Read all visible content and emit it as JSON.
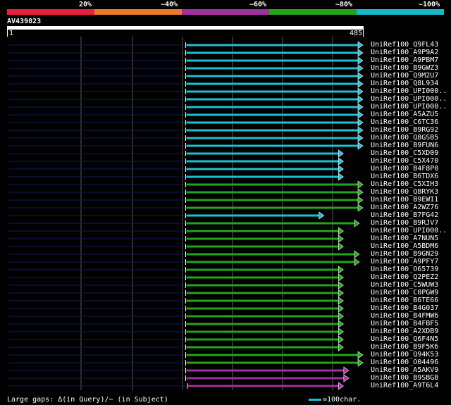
{
  "legend": {
    "labels": [
      "20%",
      "~40%",
      "~60%",
      "~80%",
      "~100%"
    ],
    "colors": [
      "#e8203c",
      "#e8782a",
      "#a0309c",
      "#28a01c",
      "#18b8c8"
    ]
  },
  "query": {
    "name": "AV439823",
    "start": "1",
    "end": "485"
  },
  "hits": [
    {
      "name": "UniRef100_Q9FL43",
      "start": 0.5,
      "end": 1.0,
      "color": "cyan"
    },
    {
      "name": "UniRef100_A9P9A2",
      "start": 0.5,
      "end": 1.0,
      "color": "cyan"
    },
    {
      "name": "UniRef100_A9PBM7",
      "start": 0.5,
      "end": 1.0,
      "color": "cyan"
    },
    {
      "name": "UniRef100_B9GWZ3",
      "start": 0.5,
      "end": 1.0,
      "color": "cyan"
    },
    {
      "name": "UniRef100_Q9M2U7",
      "start": 0.5,
      "end": 1.0,
      "color": "cyan"
    },
    {
      "name": "UniRef100_Q8L934",
      "start": 0.5,
      "end": 1.0,
      "color": "cyan"
    },
    {
      "name": "UniRef100_UPI000..",
      "start": 0.5,
      "end": 1.0,
      "color": "cyan"
    },
    {
      "name": "UniRef100_UPI000..",
      "start": 0.5,
      "end": 1.0,
      "color": "cyan"
    },
    {
      "name": "UniRef100_UPI000..",
      "start": 0.5,
      "end": 1.0,
      "color": "cyan"
    },
    {
      "name": "UniRef100_A5AZU5",
      "start": 0.5,
      "end": 1.0,
      "color": "cyan"
    },
    {
      "name": "UniRef100_C6TC36",
      "start": 0.5,
      "end": 1.0,
      "color": "cyan"
    },
    {
      "name": "UniRef100_B9RG92",
      "start": 0.5,
      "end": 1.0,
      "color": "cyan"
    },
    {
      "name": "UniRef100_Q8GSB5",
      "start": 0.5,
      "end": 1.0,
      "color": "cyan"
    },
    {
      "name": "UniRef100_B9FUN6",
      "start": 0.5,
      "end": 1.0,
      "color": "cyan"
    },
    {
      "name": "UniRef100_C5XD09",
      "start": 0.5,
      "end": 0.945,
      "color": "cyan"
    },
    {
      "name": "UniRef100_C5X470",
      "start": 0.5,
      "end": 0.945,
      "color": "cyan"
    },
    {
      "name": "UniRef100_B4F8P0",
      "start": 0.5,
      "end": 0.945,
      "color": "cyan"
    },
    {
      "name": "UniRef100_B6TDX6",
      "start": 0.5,
      "end": 0.945,
      "color": "cyan"
    },
    {
      "name": "UniRef100_C5XIH3",
      "start": 0.5,
      "end": 1.0,
      "color": "green"
    },
    {
      "name": "UniRef100_Q8RYK3",
      "start": 0.5,
      "end": 1.0,
      "color": "green"
    },
    {
      "name": "UniRef100_B9EWI1",
      "start": 0.5,
      "end": 1.0,
      "color": "green"
    },
    {
      "name": "UniRef100_A2WZ76",
      "start": 0.5,
      "end": 1.0,
      "color": "green"
    },
    {
      "name": "UniRef100_B7FG42",
      "start": 0.5,
      "end": 0.89,
      "color": "cyan"
    },
    {
      "name": "UniRef100_B9RJV7",
      "start": 0.5,
      "end": 0.99,
      "color": "green"
    },
    {
      "name": "UniRef100_UPI000..",
      "start": 0.5,
      "end": 0.945,
      "color": "green"
    },
    {
      "name": "UniRef100_A7NUN5",
      "start": 0.5,
      "end": 0.945,
      "color": "green"
    },
    {
      "name": "UniRef100_A5BDM6",
      "start": 0.5,
      "end": 0.945,
      "color": "green"
    },
    {
      "name": "UniRef100_B9GN29",
      "start": 0.5,
      "end": 0.99,
      "color": "green"
    },
    {
      "name": "UniRef100_A9PFY7",
      "start": 0.5,
      "end": 0.99,
      "color": "green"
    },
    {
      "name": "UniRef100_O65739",
      "start": 0.5,
      "end": 0.945,
      "color": "green"
    },
    {
      "name": "UniRef100_Q2PEZ2",
      "start": 0.5,
      "end": 0.945,
      "color": "green"
    },
    {
      "name": "UniRef100_C5WUW3",
      "start": 0.5,
      "end": 0.945,
      "color": "green"
    },
    {
      "name": "UniRef100_C0PGW9",
      "start": 0.5,
      "end": 0.945,
      "color": "green"
    },
    {
      "name": "UniRef100_B6TE66",
      "start": 0.5,
      "end": 0.945,
      "color": "green"
    },
    {
      "name": "UniRef100_B4G037",
      "start": 0.5,
      "end": 0.945,
      "color": "green"
    },
    {
      "name": "UniRef100_B4FMW6",
      "start": 0.5,
      "end": 0.945,
      "color": "green"
    },
    {
      "name": "UniRef100_B4FBF5",
      "start": 0.5,
      "end": 0.945,
      "color": "green"
    },
    {
      "name": "UniRef100_A2XDB9",
      "start": 0.5,
      "end": 0.945,
      "color": "green"
    },
    {
      "name": "UniRef100_Q6F4N5",
      "start": 0.5,
      "end": 0.945,
      "color": "green"
    },
    {
      "name": "UniRef100_B9F5K6",
      "start": 0.5,
      "end": 0.945,
      "color": "green"
    },
    {
      "name": "UniRef100_Q94K53",
      "start": 0.5,
      "end": 1.0,
      "color": "green"
    },
    {
      "name": "UniRef100_O04496",
      "start": 0.5,
      "end": 1.0,
      "color": "green"
    },
    {
      "name": "UniRef100_A5AKV9",
      "start": 0.5,
      "end": 0.96,
      "color": "purple"
    },
    {
      "name": "UniRef100_B9SBG8",
      "start": 0.5,
      "end": 0.96,
      "color": "purple"
    },
    {
      "name": "UniRef100_A9T6L4",
      "start": 0.505,
      "end": 0.945,
      "color": "purple"
    }
  ],
  "footer": {
    "gaps_text": "Large gaps: ∆(in Query)/− (in Subject)",
    "scale_text": "=100char."
  },
  "colors": {
    "cyan": "#20c0d0",
    "green": "#20a818",
    "purple": "#a030a0",
    "track": "#101c58",
    "grid": "#5a5a5a",
    "start_tick": "#ffffff"
  }
}
